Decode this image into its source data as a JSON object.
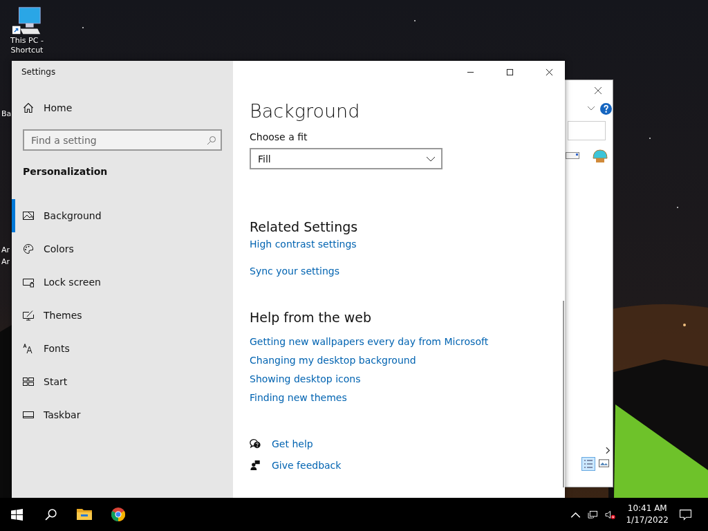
{
  "desktop": {
    "icons": [
      {
        "label": "This PC - Shortcut"
      }
    ],
    "cut_labels": [
      "Ba",
      "Ar",
      "Ar"
    ]
  },
  "settings": {
    "title": "Settings",
    "home": "Home",
    "search": {
      "placeholder": "Find a setting"
    },
    "section": "Personalization",
    "nav": [
      {
        "kind": "background",
        "label": "Background",
        "selected": true
      },
      {
        "kind": "colors",
        "label": "Colors",
        "selected": false
      },
      {
        "kind": "lock",
        "label": "Lock screen",
        "selected": false
      },
      {
        "kind": "themes",
        "label": "Themes",
        "selected": false
      },
      {
        "kind": "fonts",
        "label": "Fonts",
        "selected": false
      },
      {
        "kind": "start",
        "label": "Start",
        "selected": false
      },
      {
        "kind": "taskbar",
        "label": "Taskbar",
        "selected": false
      }
    ],
    "heading": "Background",
    "fit": {
      "label": "Choose a fit",
      "value": "Fill"
    },
    "related": {
      "heading": "Related Settings",
      "links": [
        "High contrast settings",
        "Sync your settings"
      ]
    },
    "help": {
      "heading": "Help from the web",
      "links": [
        "Getting new wallpapers every day from Microsoft",
        "Changing my desktop background",
        "Showing desktop icons",
        "Finding new themes"
      ]
    },
    "actions": [
      {
        "kind": "help",
        "label": "Get help"
      },
      {
        "kind": "feedback",
        "label": "Give feedback"
      }
    ]
  },
  "taskbar": {
    "apps": [
      {
        "kind": "start"
      },
      {
        "kind": "search"
      },
      {
        "kind": "explorer"
      },
      {
        "kind": "chrome"
      }
    ],
    "time": "10:41 AM",
    "date": "1/17/2022"
  }
}
